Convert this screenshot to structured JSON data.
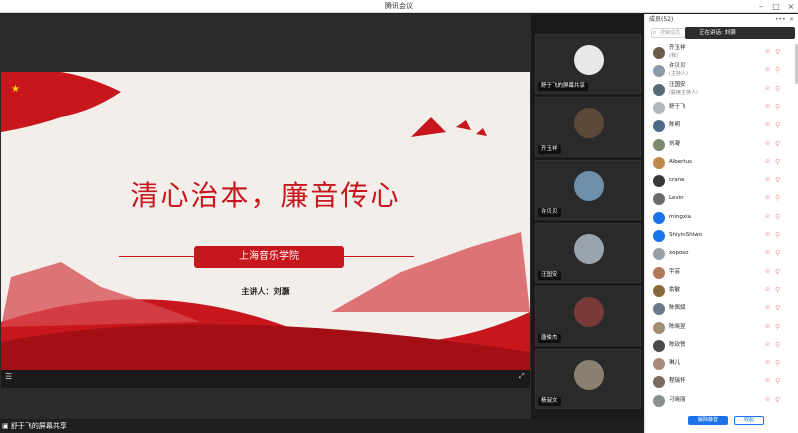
{
  "window": {
    "title": "腾讯会议"
  },
  "slide": {
    "title": "清心治本，廉音传心",
    "banner": "上海音乐学院",
    "speaker": "主讲人：刘灏"
  },
  "share_label": "舒于飞的屏幕共享",
  "tiles": [
    {
      "name": "舒于飞的屏幕共享",
      "color": "#e8e8e8"
    },
    {
      "name": "齐玉祥",
      "color": "#5a4a3a"
    },
    {
      "name": "许贝贝",
      "color": "#6f8fa8"
    },
    {
      "name": "汪国安",
      "color": "#9aa4ae"
    },
    {
      "name": "唐俊杰",
      "color": "#7a3a3a"
    },
    {
      "name": "杨淑文",
      "color": "#8a8070"
    }
  ],
  "panel": {
    "title": "成员(52)",
    "search_placeholder": "搜索成员",
    "toast": "正在讲话: 刘灏",
    "members": [
      {
        "name": "齐玉祥",
        "role": "(我)"
      },
      {
        "name": "许贝贝",
        "role": "(主持人)"
      },
      {
        "name": "汪国安",
        "role": "(联席主持人)"
      },
      {
        "name": "舒于飞",
        "role": ""
      },
      {
        "name": "陈明",
        "role": ""
      },
      {
        "name": "刘凝",
        "role": ""
      },
      {
        "name": "Albertus",
        "role": ""
      },
      {
        "name": "crane",
        "role": ""
      },
      {
        "name": "Levin",
        "role": ""
      },
      {
        "name": "mingxia",
        "role": ""
      },
      {
        "name": "ShiyinShiwo",
        "role": ""
      },
      {
        "name": "xoposo",
        "role": ""
      },
      {
        "name": "宇芸",
        "role": ""
      },
      {
        "name": "俞敏",
        "role": ""
      },
      {
        "name": "陈佩斌",
        "role": ""
      },
      {
        "name": "陈晓昱",
        "role": ""
      },
      {
        "name": "陈钦赞",
        "role": ""
      },
      {
        "name": "琳儿",
        "role": ""
      },
      {
        "name": "程瑞怀",
        "role": ""
      },
      {
        "name": "刁晓丽",
        "role": ""
      }
    ],
    "mute_all": "解除静音",
    "more": "收起"
  }
}
